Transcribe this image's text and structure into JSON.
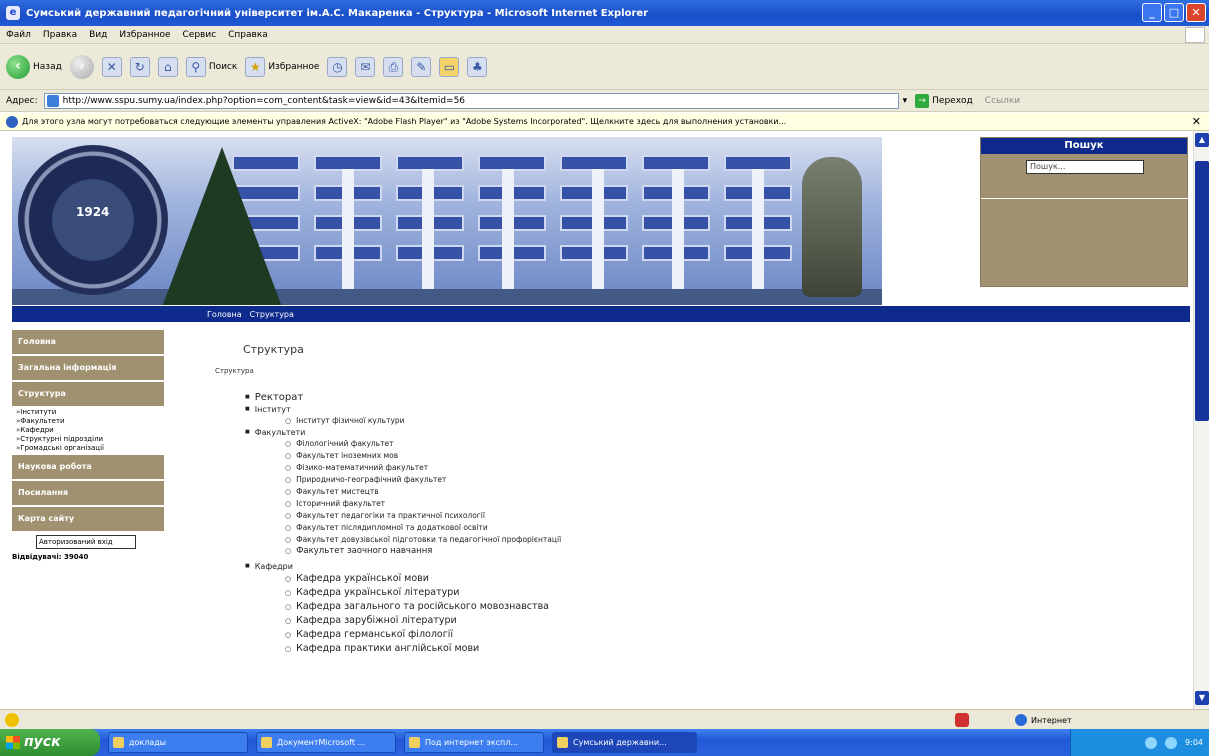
{
  "window": {
    "title": "Сумський державний педагогічний університет ім.А.С. Макаренка - Структура - Microsoft Internet Explorer",
    "btn_min": "_",
    "btn_max": "□",
    "btn_close": "✕"
  },
  "menu": [
    "Файл",
    "Правка",
    "Вид",
    "Избранное",
    "Сервис",
    "Справка"
  ],
  "toolbar": {
    "back": "Назад",
    "search": "Поиск",
    "favorites": "Избранное"
  },
  "address": {
    "label": "Адрес:",
    "url": "http://www.sspu.sumy.ua/index.php?option=com_content&task=view&id=43&Itemid=56",
    "go": "Переход",
    "links": "Ссылки"
  },
  "infobar": {
    "text": "Для этого узла могут потребоваться следующие элементы управления ActiveX: \"Adobe Flash Player\" из \"Adobe Systems Incorporated\". Щелкните здесь для выполнения установки..."
  },
  "banner": {
    "year": "1924"
  },
  "search": {
    "title": "Пошук",
    "placeholder": "Пошук..."
  },
  "nav": {
    "crumbs": [
      "Головна",
      "Структура"
    ]
  },
  "sidebar": {
    "main": "Головна",
    "general": "Загальна інформація",
    "structure": "Структура",
    "sub": [
      "Інститути",
      "Факультети",
      "Кафедри",
      "Структурні підрозділи",
      "Громадські організації"
    ],
    "research": "Наукова робота",
    "links": "Посилання",
    "sitemap": "Карта сайту",
    "author_box": "Авторизований вхід",
    "visits": "Відвідувачі: 39040"
  },
  "content": {
    "heading": "Структура",
    "sub": "Структура",
    "rectorate": "Ректорат",
    "institute": "Інститут",
    "institute_items": [
      "Інститут фізичної культури"
    ],
    "faculties": "Факультети",
    "faculty_items": [
      "Філологічний факультет",
      "Факультет іноземних мов",
      "Фізико-математичний факультет",
      "Природничо-географічний факультет",
      "Факультет мистецтв",
      "Історичний факультет",
      "Факультет педагогіки та практичної психології",
      "Факультет післядипломної та додаткової освіти",
      "Факультет довузівської підготовки та педагогічної профорієнтації",
      "Факультет заочного навчання"
    ],
    "departments": "Кафедри",
    "department_items": [
      "Кафедра української мови",
      "Кафедра української літератури",
      "Кафедра загального та російського мовознавства",
      "Кафедра зарубіжної літератури",
      "Кафедра германської філології",
      "Кафедра практики англійської мови"
    ]
  },
  "status": {
    "zone": "Интернет"
  },
  "taskbar": {
    "start": "пуск",
    "items": [
      "доклады",
      "ДокументMicrosoft ...",
      "Под интернет экспл...",
      "Сумський державни..."
    ],
    "clock": "9:04"
  }
}
